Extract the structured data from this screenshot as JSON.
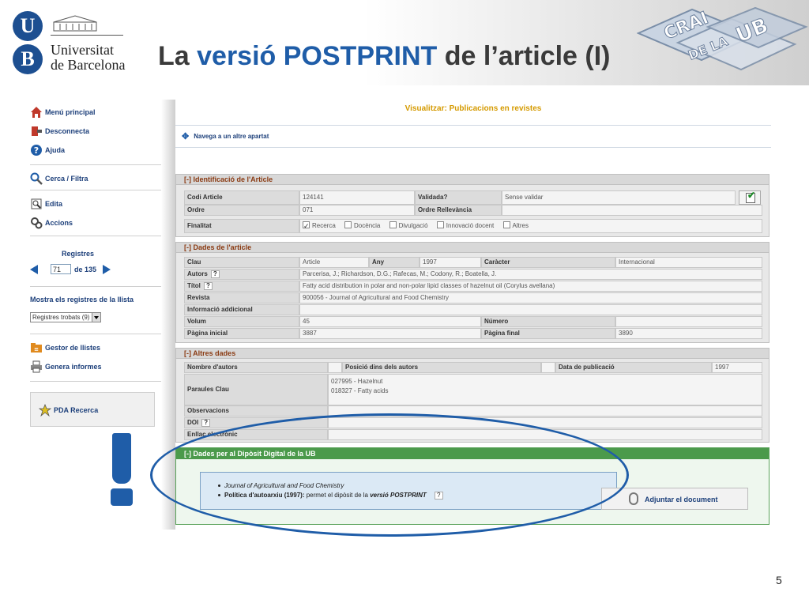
{
  "slide": {
    "title_prefix": "La ",
    "title_highlight": "versió POSTPRINT",
    "title_suffix": " de l’article (I)",
    "university_line1": "Universitat",
    "university_line2": "de Barcelona",
    "ub_u": "U",
    "ub_b": "B",
    "crai_logo_text": "CRAI DE LA UB",
    "page_number": "5",
    "colors": {
      "accent": "#1f5da8",
      "section_header_text": "#8a3a12",
      "green_section": "#4b9a4b",
      "view_title": "#d59a00"
    }
  },
  "sidebar": {
    "menu_principal": "Menú principal",
    "desconnecta": "Desconnecta",
    "ajuda": "Ajuda",
    "cerca": "Cerca / Filtra",
    "edita": "Edita",
    "accions": "Accions",
    "registres_label": "Registres",
    "registre_actual": "71",
    "registre_total": "de 135",
    "mostra_label": "Mostra els registres de la llista",
    "mostra_select": "Registres trobats (9)",
    "gestor": "Gestor de llistes",
    "genera": "Genera informes",
    "pda": "PDA Recerca"
  },
  "main": {
    "view_title": "Visualitzar: Publicacions en revistes",
    "navega": "Navega a un altre apartat",
    "ident": {
      "header_toggle": "[-]",
      "header": "Identificació de l'Article",
      "codi_label": "Codi Article",
      "codi_val": "124141",
      "validada_label": "Validada?",
      "validada_val": "Sense validar",
      "ordre_label": "Ordre",
      "ordre_val": "071",
      "ordre_rell_label": "Ordre Rellevància",
      "finalitat_label": "Finalitat",
      "finalitat_opts": [
        "Recerca",
        "Docència",
        "Divulgació",
        "Innovació docent",
        "Altres"
      ]
    },
    "dades": {
      "header_toggle": "[-]",
      "header": "Dades de l'article",
      "clau_label": "Clau",
      "clau_val": "Article",
      "any_label": "Any",
      "any_val": "1997",
      "caracter_label": "Caràcter",
      "caracter_val": "Internacional",
      "autors_label": "Autors",
      "autors_val": "Parcerisa, J.; Richardson, D.G.; Rafecas, M.; Codony, R.; Boatella, J.",
      "titol_label": "Títol",
      "titol_val": "Fatty acid distribution in polar and non-polar lipid classes of hazelnut oil (Corylus avellana)",
      "revista_label": "Revista",
      "revista_val": "900056 - Journal of Agricultural and Food Chemistry",
      "info_label": "Informació addicional",
      "volum_label": "Volum",
      "volum_val": "45",
      "numero_label": "Número",
      "pag_ini_label": "Pàgina inicial",
      "pag_ini_val": "3887",
      "pag_fin_label": "Pàgina final",
      "pag_fin_val": "3890"
    },
    "altres": {
      "header_toggle": "[-]",
      "header": "Altres dades",
      "nombre_label": "Nombre d'autors",
      "posicio_label": "Posició dins dels autors",
      "data_pub_label": "Data de publicació",
      "data_pub_val": "1997",
      "paraules_label": "Paraules Clau",
      "paraula1": "027995 - Hazelnut",
      "paraula2": "018327 - Fatty acids",
      "observ_label": "Observacions",
      "doi_label": "DOI",
      "enllac_label": "Enllaç electrònic",
      "qmark": "?"
    },
    "diposit": {
      "header_toggle": "[-]",
      "header": "Dades per al Dipòsit Digital de la UB",
      "journal": "Journal of Agricultural and Food Chemistry",
      "politica_label": "Política d'autoarxiu (1997):",
      "politica_text": " permet el dipòsit de la ",
      "politica_em": "versió POSTPRINT",
      "adjuntar": "Adjuntar el document"
    }
  }
}
